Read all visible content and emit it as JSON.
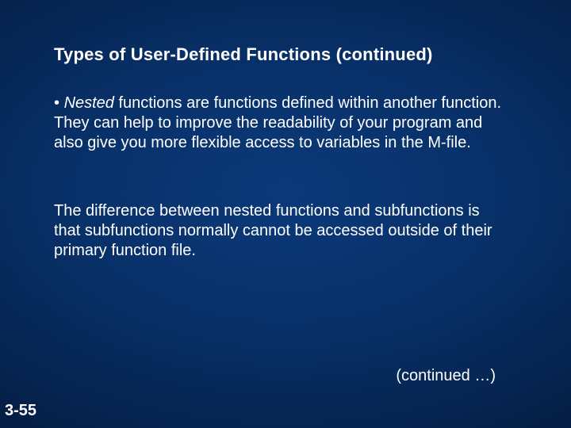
{
  "slide": {
    "title": "Types of User-Defined Functions (continued)",
    "bullet_marker": "•  ",
    "nested_term": "Nested",
    "body1_rest": " functions are functions defined within another function. They can help to  improve the readability of your program and also give you more flexible access to variables in the M-file.",
    "body2": "The difference between nested functions and subfunctions is that subfunctions normally cannot be accessed outside of their primary function file.",
    "continued": "(continued …)",
    "page_number": "3-55"
  }
}
